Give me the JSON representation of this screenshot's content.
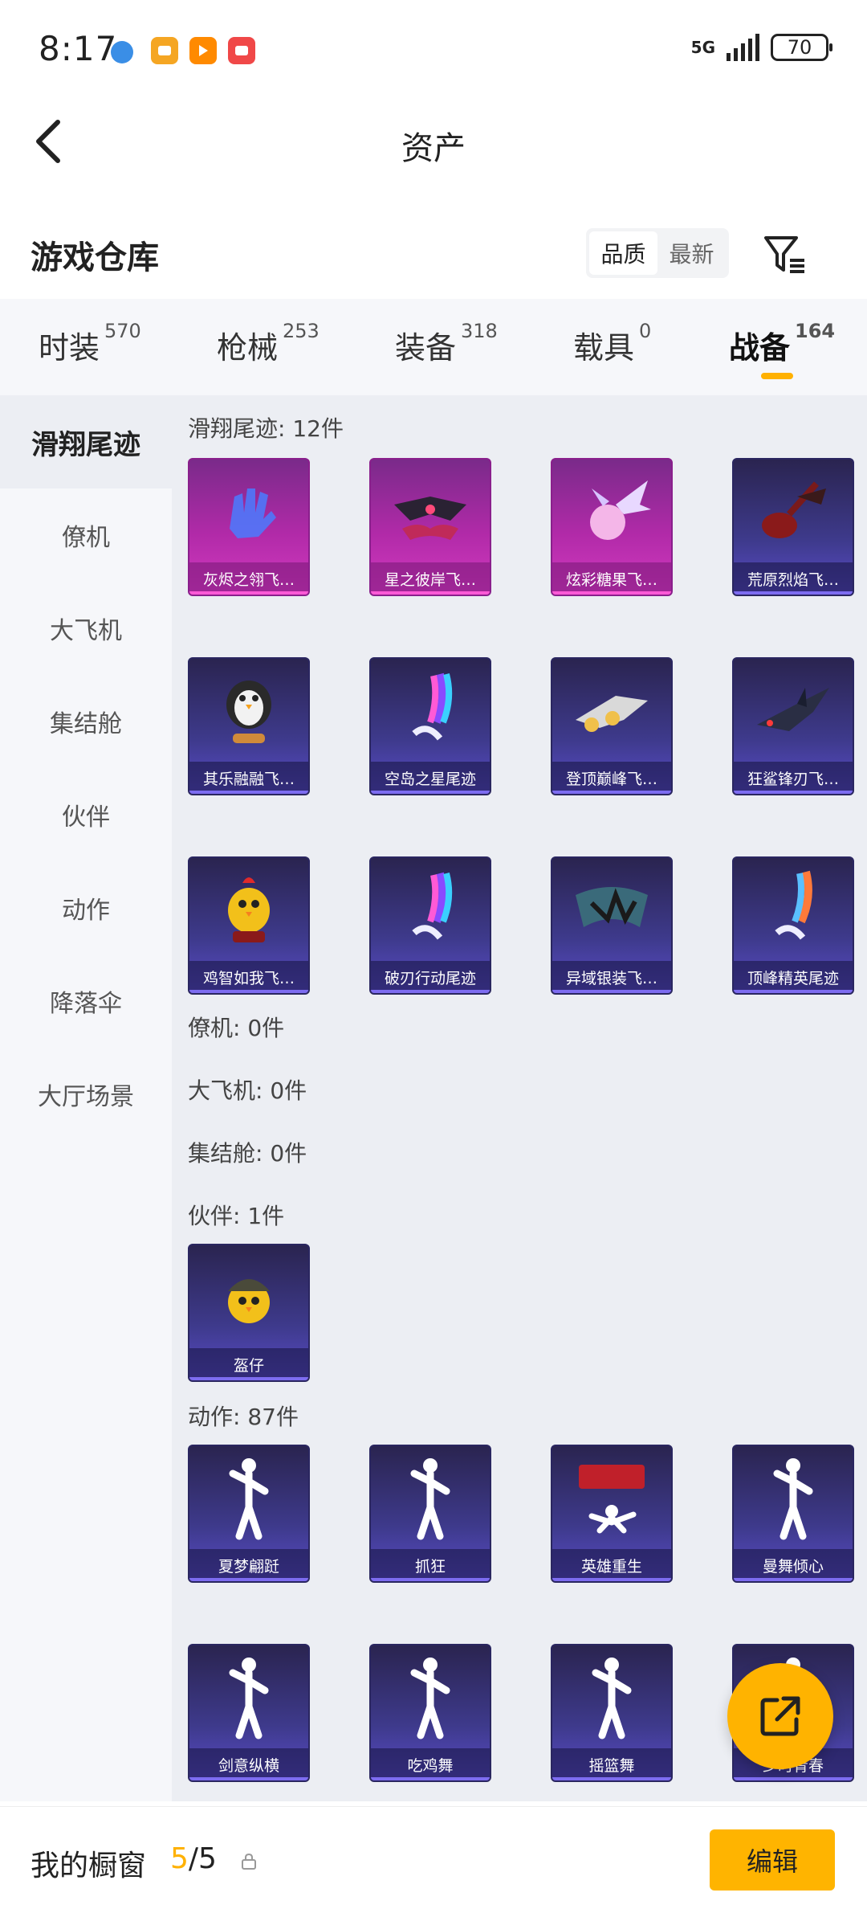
{
  "status_bar": {
    "time": "8:17",
    "network": "5G",
    "battery": "70",
    "app_icons": [
      {
        "name": "browser-icon",
        "color": "#3a8ee6"
      },
      {
        "name": "notes-icon",
        "color": "#f5a623"
      },
      {
        "name": "video-icon",
        "color": "#ff8a00"
      },
      {
        "name": "store-icon",
        "color": "#f04848"
      }
    ]
  },
  "nav": {
    "title": "资产"
  },
  "header": {
    "section_title": "游戏仓库",
    "sort_options": [
      "品质",
      "最新"
    ],
    "active_sort": "品质"
  },
  "tabs": [
    {
      "label": "时装",
      "count": "570"
    },
    {
      "label": "枪械",
      "count": "253"
    },
    {
      "label": "装备",
      "count": "318"
    },
    {
      "label": "载具",
      "count": "0"
    },
    {
      "label": "战备",
      "count": "164"
    }
  ],
  "active_tab": "战备",
  "sidebar": {
    "items": [
      "滑翔尾迹",
      "僚机",
      "大飞机",
      "集结舱",
      "伙伴",
      "动作",
      "降落伞",
      "大厅场景"
    ],
    "active": "滑翔尾迹"
  },
  "groups": {
    "glide": {
      "title": "滑翔尾迹: 12件",
      "items": [
        {
          "name": "灰烬之翎飞…",
          "rarity": "pink",
          "icon": "glove-icon"
        },
        {
          "name": "星之彼岸飞…",
          "rarity": "pink",
          "icon": "wing-icon"
        },
        {
          "name": "炫彩糖果飞…",
          "rarity": "pink",
          "icon": "candy-icon"
        },
        {
          "name": "荒原烈焰飞…",
          "rarity": "purple",
          "icon": "guitar-icon"
        },
        {
          "name": "其乐融融飞…",
          "rarity": "purple",
          "icon": "penguin-icon"
        },
        {
          "name": "空岛之星尾迹",
          "rarity": "purple",
          "icon": "rainbow-trail-icon"
        },
        {
          "name": "登顶巅峰飞…",
          "rarity": "purple",
          "icon": "jet-icon"
        },
        {
          "name": "狂鲨锋刃飞…",
          "rarity": "purple",
          "icon": "shark-icon"
        },
        {
          "name": "鸡智如我飞…",
          "rarity": "purple",
          "icon": "chicken-icon"
        },
        {
          "name": "破刃行动尾迹",
          "rarity": "purple",
          "icon": "rainbow-trail-icon"
        },
        {
          "name": "异域银装飞…",
          "rarity": "purple",
          "icon": "silver-wing-icon"
        },
        {
          "name": "顶峰精英尾迹",
          "rarity": "purple",
          "icon": "flame-trail-icon"
        }
      ]
    },
    "wingman": {
      "title": "僚机: 0件"
    },
    "plane": {
      "title": "大飞机: 0件"
    },
    "pod": {
      "title": "集结舱: 0件"
    },
    "partner": {
      "title": "伙伴: 1件",
      "items": [
        {
          "name": "盔仔",
          "rarity": "purple",
          "icon": "helmet-chick-icon"
        }
      ]
    },
    "emote": {
      "title": "动作: 87件",
      "items": [
        {
          "name": "夏梦翩跹",
          "rarity": "purple",
          "icon": "dancer-icon"
        },
        {
          "name": "抓狂",
          "rarity": "purple",
          "icon": "dancer-icon"
        },
        {
          "name": "英雄重生",
          "rarity": "purple",
          "icon": "hero-icon"
        },
        {
          "name": "曼舞倾心",
          "rarity": "purple",
          "icon": "dancer-icon"
        },
        {
          "name": "剑意纵横",
          "rarity": "purple",
          "icon": "dancer-icon"
        },
        {
          "name": "吃鸡舞",
          "rarity": "purple",
          "icon": "dancer-icon"
        },
        {
          "name": "摇篮舞",
          "rarity": "purple",
          "icon": "dancer-icon"
        },
        {
          "name": "少时青春",
          "rarity": "purple",
          "icon": "dancer-icon"
        }
      ]
    }
  },
  "bottom": {
    "showcase_label": "我的橱窗",
    "showcase_current": "5",
    "showcase_total": "/5",
    "edit_label": "编辑"
  },
  "colors": {
    "accent": "#ffb100",
    "card_purple": "#3e3a8c",
    "card_pink": "#b12aa8"
  }
}
